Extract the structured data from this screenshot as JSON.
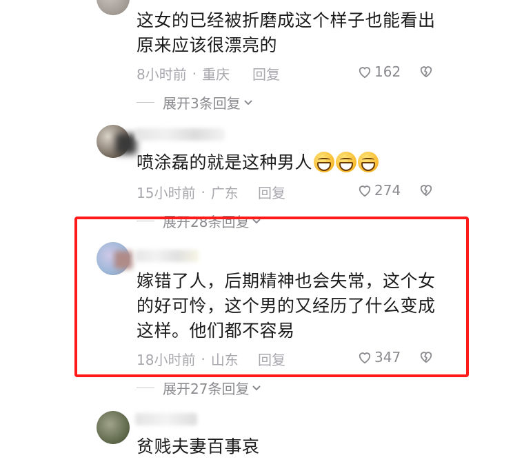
{
  "comments": [
    {
      "text_line1": "这女的已经被折磨成这个样子也能看出",
      "text_line2": "原来应该很漂亮的",
      "time": "8小时前",
      "sep": "·",
      "location": "重庆",
      "reply": "回复",
      "likes": "162",
      "expand": "展开3条回复"
    },
    {
      "text_line1": "喷涂磊的就是这种男人",
      "time": "15小时前",
      "sep": "·",
      "location": "广东",
      "reply": "回复",
      "likes": "274",
      "expand": "展开28条回复"
    },
    {
      "text_line1": "嫁错了人，后期精神也会失常，这个女",
      "text_line2": "的好可怜，这个男的又经历了什么变成",
      "text_line3": "这样。他们都不容易",
      "time": "18小时前",
      "sep": "·",
      "location": "山东",
      "reply": "回复",
      "likes": "347",
      "expand": "展开27条回复"
    },
    {
      "text_line1": "贫贱夫妻百事哀"
    }
  ],
  "icons": {
    "like": "heart-outline-icon",
    "dislike": "broken-heart-icon",
    "expand_chevron": "chevron-down-icon",
    "emoji": "grinning-face-emoji"
  },
  "colors": {
    "highlight_border": "#ff1a1a",
    "meta_text": "#a7a7ad"
  }
}
